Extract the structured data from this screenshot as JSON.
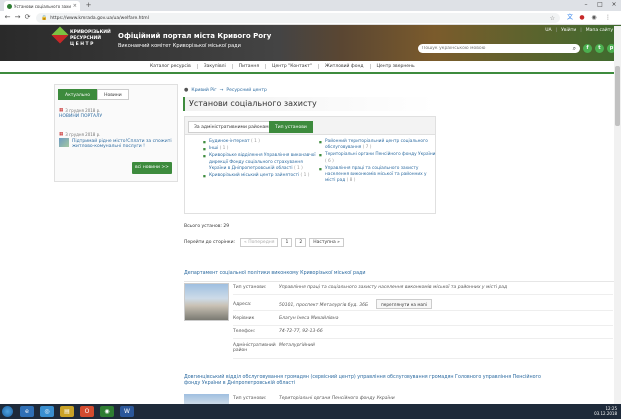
{
  "browser": {
    "tab_title": "Установи соціального захисту",
    "url": "https://www.kmrada.gov.ua/ua/welfare.html"
  },
  "header": {
    "logo_line1": "КРИВОРІЗЬКИЙ",
    "logo_line2": "РЕСУРСНИЙ",
    "logo_line3": "ЦЕНТР",
    "portal_title": "Офіційний портал міста Кривого Рогу",
    "portal_sub": "Виконавчий комітет Криворізької міської ради",
    "lang": "UA",
    "login": "Увійти",
    "sitemap": "Мапа сайту",
    "search_placeholder": "Пошук українською мовою",
    "socials": [
      "f",
      "t",
      "p",
      "g"
    ]
  },
  "nav": [
    "Каталог ресурсів",
    "Закупівлі",
    "Питання",
    "Центр \"Контакт\"",
    "Житловий фонд",
    "Центр звернень"
  ],
  "news": {
    "tab_current": "Актуально",
    "tab_news": "Новини",
    "item1_date": "3 грудня 2018 р.",
    "item1_title": "НОВИНИ ПОРТАЛУ",
    "item2_date": "3 грудня 2018 р.",
    "item2_title": "Підтримай рідне місто!Сплати за спожиті житлово-комунальні послуги !",
    "all_news": "всі новини >>"
  },
  "main": {
    "breadcrumb_home": "Кривий Ріг",
    "breadcrumb_sep": "→",
    "breadcrumb_current": "Ресурсний центр",
    "page_title": "Установи соціального захисту",
    "filter_tab1": "За адміністративними районами",
    "filter_tab2": "Тип установи",
    "filter_left": [
      {
        "label": "Будинок-інтернат",
        "count": "( 1 )"
      },
      {
        "label": "Інші",
        "count": "( 1 )"
      },
      {
        "label": "Криворізьке відділення Управління виконавчої дирекції Фонду соціального страхування України в Дніпропетровській області",
        "count": "( 1 )"
      },
      {
        "label": "Криворізький міський центр зайнятості",
        "count": "( 1 )"
      }
    ],
    "filter_right": [
      {
        "label": "Районний територіальний центр соціального обслуговування",
        "count": "( 7 )"
      },
      {
        "label": "Територіальні органи Пенсійного фонду України",
        "count": "( 6 )"
      },
      {
        "label": "Управління праці та соціального захисту населення виконкомів міської та районних у місті рад",
        "count": "( 8 )"
      }
    ],
    "total": "Всього установ: 29",
    "pager_label": "Перейти до сторінки:",
    "pager_prev": "« Попередня",
    "pager_page1": "1",
    "pager_page2": "2",
    "pager_next": "Наступна »"
  },
  "org1": {
    "title": "Департамент соціальної політики виконкому Криворізької міської ради",
    "type_k": "Тип установи:",
    "type_v": "Управління праці та соціального захисту населення виконкомів міської та районних у місті рад",
    "address_k": "Адреса:",
    "address_v": "50101, проспект Металургів буд. 36Б",
    "map_btn": "переглянути на мапі",
    "head_k": "Керівник",
    "head_v": "Благун Інеса Михайлівна",
    "phone_k": "Телефон:",
    "phone_v": "74-72-77, 92-13-66",
    "district_k": "Адміністративний район",
    "district_v": "Металургійний"
  },
  "org2": {
    "title": "Довгинцівський відділ обслуговування громадян (сервісний центр) управління обслуговування громадян Головного управління Пенсійного фонду України в Дніпропетровській області",
    "type_k": "Тип установи:",
    "type_v": "Територіальні органи Пенсійного фонду України"
  },
  "taskbar": {
    "time": "12:25",
    "date": "03.12.2018"
  }
}
